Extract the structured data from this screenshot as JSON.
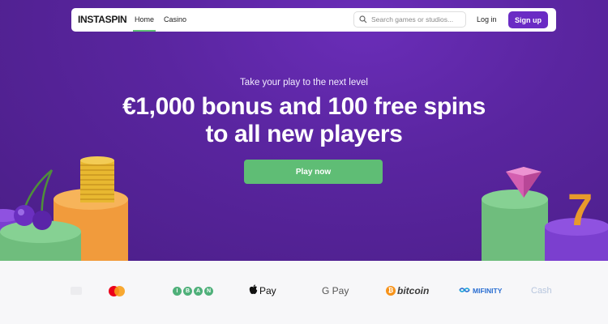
{
  "brand": {
    "logo_text": "INSTASPIN",
    "accent": "#6a2bc4",
    "green": "#5fbd75",
    "hero_bg": "#5a25a0"
  },
  "nav": {
    "home_label": "Home",
    "casino_label": "Casino",
    "search_placeholder": "Search games or studios...",
    "login_label": "Log in",
    "signup_label": "Sign up",
    "active_tab": "Home"
  },
  "hero": {
    "tagline": "Take your play to the next level",
    "headline": "€1,000 bonus and 100 free spins to all new players",
    "cta_label": "Play now"
  },
  "payments": {
    "items": [
      {
        "name": "mastercard"
      },
      {
        "name": "iban",
        "letters": [
          "I",
          "B",
          "A",
          "N"
        ]
      },
      {
        "name": "apple-pay",
        "label": "Pay"
      },
      {
        "name": "google-pay",
        "label": "G Pay"
      },
      {
        "name": "bitcoin",
        "label": "bitcoin"
      },
      {
        "name": "mifinity",
        "label": "MIFINITY"
      },
      {
        "name": "cashlib",
        "label": "Cash"
      }
    ]
  }
}
